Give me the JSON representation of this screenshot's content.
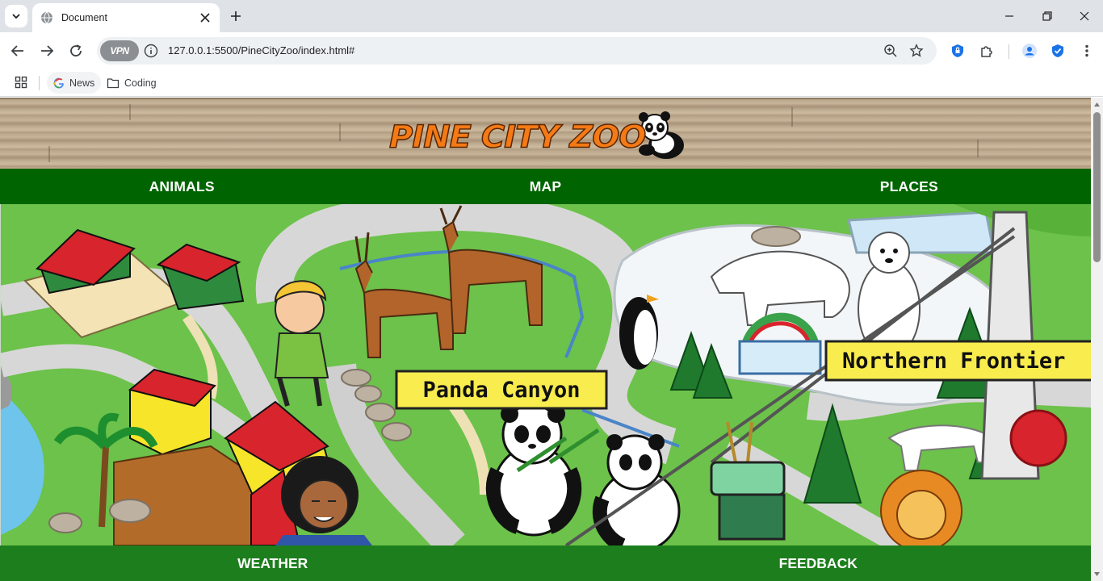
{
  "browser": {
    "tab_title": "Document",
    "url_host": "127.0.0.1",
    "url_rest": ":5500/PineCityZoo/index.html#",
    "vpn_label": "VPN",
    "bookmarks": [
      {
        "label": "News",
        "icon": "google-icon"
      },
      {
        "label": "Coding",
        "icon": "folder-icon"
      }
    ]
  },
  "site": {
    "logo_text": "PINE CITY ZOO",
    "nav": [
      "ANIMALS",
      "MAP",
      "PLACES"
    ],
    "map_labels": {
      "panda_canyon": "Panda Canyon",
      "northern_frontier": "Northern Frontier"
    },
    "footer_nav": [
      "WEATHER",
      "FEEDBACK"
    ]
  },
  "colors": {
    "nav_green": "#006400",
    "footer_green": "#1d7e1d",
    "logo_orange": "#f47a16",
    "grass": "#6cc24a",
    "sign_yellow": "#f8ec4e"
  }
}
